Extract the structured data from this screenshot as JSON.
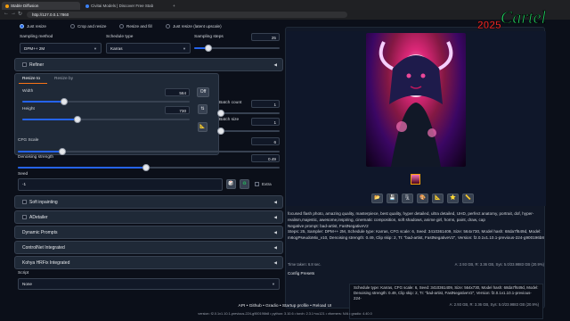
{
  "browser": {
    "tabs": [
      {
        "title": "Stable Diffusion"
      },
      {
        "title": "Civitai Models | Discover Free Stab"
      }
    ],
    "url": "http://127.0.0.1:7860",
    "add_tab": "+"
  },
  "resize_mode": {
    "options": [
      "Just resize",
      "Crop and resize",
      "Resize and fill",
      "Just resize (latent upscale)"
    ],
    "selected": "Just resize"
  },
  "sampling": {
    "method_label": "Sampling method",
    "method_value": "DPM++ 2M",
    "schedule_label": "Schedule type",
    "schedule_value": "Karras",
    "steps_label": "Sampling steps",
    "steps_value": "25",
    "steps_fraction": 0.17
  },
  "refiner": {
    "label": "Refiner"
  },
  "resize": {
    "tab_to": "Resize to",
    "tab_by": "Resize by",
    "width_label": "Width",
    "width_value": "564",
    "width_fraction": 0.25,
    "height_label": "Height",
    "height_value": "730",
    "height_fraction": 0.33,
    "off_label": "Off",
    "swap_icon": "⇅",
    "aspect_icon": "📐"
  },
  "batch": {
    "count_label": "Batch count",
    "count_value": "1",
    "size_label": "Batch size",
    "size_value": "1"
  },
  "cfg": {
    "label": "CFG Scale",
    "value": "6",
    "fraction": 0.17
  },
  "denoise": {
    "label": "Denoising strength",
    "value": "0.49",
    "fraction": 0.49
  },
  "seed": {
    "label": "Seed",
    "value": "-1",
    "dice_icon": "🎲",
    "recycle_icon": "♻",
    "extra_label": "Extra"
  },
  "accordions": [
    {
      "label": "Soft inpainting",
      "checkbox": true
    },
    {
      "label": "ADetailer",
      "checkbox": true
    },
    {
      "label": "Dynamic Prompts",
      "checkbox": false
    },
    {
      "label": "ControlNet Integrated",
      "checkbox": false
    },
    {
      "label": "Kohya HRFix Integrated",
      "checkbox": false
    }
  ],
  "script": {
    "label": "Script",
    "value": "None"
  },
  "output": {
    "tools": [
      "📂",
      "💾",
      "🗜",
      "🎨",
      "📐",
      "⭐",
      "📏"
    ],
    "prompt_text": "focused flash photo, amazing quality, masterpiece, best quality, hyper detailed, ultra detailed, UHD, perfect anatomy, portrait, dof, hyper-realism,majestic, awesome,inspiring, cinematic composition, soft shadows, anime girl, horns, paint, draw, cap",
    "negative_text": "Negative prompt: bad-artist, FastNegativeV2",
    "params_text": "Steps: 25, Sampler: DPM++ 2M, Schedule type: Karras, CFG scale: 6, Seed: 3410361409, Size: 564x730, Model hash: 68da7f649d, Model: m6ogPseudoMix_v10, Denoising strength: 0.49, Clip skip: 2, TI: \"bad-artist, FastNegativeV2\", Version: f2.0.1v1.10.1-previous-224-g900196b8",
    "time_taken": "Time taken: 6.8 sec.",
    "vram_text": "A: 2.93 GB, R: 3.36 GB, Sys: 5.0/23.9883 GB (20.9%)",
    "config_presets": "Config Presets"
  },
  "toast": {
    "line1": "Schedule type: Karras, CFG scale: 6, Seed: 3410361409, Size: 564x730, Model hash: 68da7f649d, Model:",
    "line2": "Denoising strength: 0.49, Clip skip: 2, TI: \"bad-artist, FastNegativeV2\", Version: f2.0.1v1.10.1-previous-224-",
    "line3": "A: 2.93 GB, R: 3.36 GB, Sys: 5.0/23.9883 GB (20.9%)"
  },
  "footer": {
    "links": [
      "API",
      "Github",
      "Gradio",
      "Startup profile",
      "Reload UI"
    ],
    "version": "version: f2.0.1v1.10.1-previous-224-g900196b8 • python: 3.10.6 • torch: 2.3.1+cu121 • xformers: N/A • gradio: 4.40.0"
  },
  "logo": {
    "text": "Cartel",
    "year": "2025"
  }
}
